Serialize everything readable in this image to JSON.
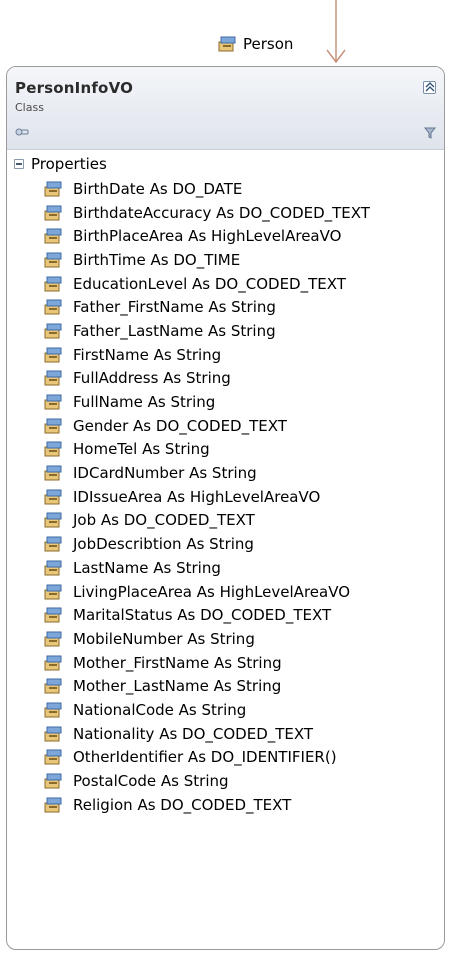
{
  "association": {
    "label": "Person",
    "icon": "property-icon"
  },
  "class_shape": {
    "name": "PersonInfoVO",
    "stereotype": "Class",
    "section": {
      "label": "Properties",
      "items": [
        "BirthDate As DO_DATE",
        "BirthdateAccuracy As DO_CODED_TEXT",
        "BirthPlaceArea As HighLevelAreaVO",
        "BirthTime As DO_TIME",
        "EducationLevel As DO_CODED_TEXT",
        "Father_FirstName As String",
        "Father_LastName As String",
        "FirstName As String",
        "FullAddress As String",
        "FullName As String",
        "Gender As DO_CODED_TEXT",
        "HomeTel As String",
        "IDCardNumber As String",
        "IDIssueArea As HighLevelAreaVO",
        "Job As DO_CODED_TEXT",
        "JobDescribtion As String",
        "LastName As String",
        "LivingPlaceArea As HighLevelAreaVO",
        "MaritalStatus As DO_CODED_TEXT",
        "MobileNumber As String",
        "Mother_FirstName As String",
        "Mother_LastName As String",
        "NationalCode As String",
        "Nationality As DO_CODED_TEXT",
        "OtherIdentifier As DO_IDENTIFIER()",
        "PostalCode As String",
        "Religion As DO_CODED_TEXT"
      ]
    }
  },
  "icons": {
    "property": "property-icon",
    "collapse": "collapse-chevron-icon",
    "key": "key-icon",
    "filter": "filter-icon",
    "section_toggle": "section-collapse-icon"
  },
  "colors": {
    "arrow": "#c8927a",
    "border": "#9a9a9a",
    "header_top": "#f4f6f9",
    "header_bottom": "#dfe4ec"
  }
}
